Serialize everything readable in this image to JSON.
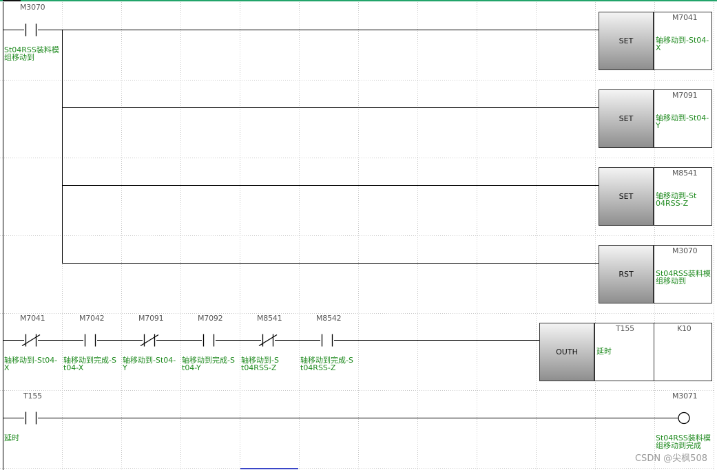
{
  "rungs": [
    {
      "contacts": [
        {
          "device": "M3070",
          "type": "no",
          "comment": "St04RSS装料模组移动到"
        }
      ],
      "outputs": [
        {
          "instruction": "SET",
          "device": "M7041",
          "comment": "轴移动到-St04-X"
        },
        {
          "instruction": "SET",
          "device": "M7091",
          "comment": "轴移动到-St04-Y"
        },
        {
          "instruction": "SET",
          "device": "M8541",
          "comment": "轴移动到-St04RSS-Z"
        },
        {
          "instruction": "RST",
          "device": "M3070",
          "comment": "St04RSS装料模组移动到"
        }
      ]
    },
    {
      "contacts": [
        {
          "device": "M7041",
          "type": "nc",
          "comment": "轴移动到-St04-X"
        },
        {
          "device": "M7042",
          "type": "no",
          "comment": "轴移动到完成-St04-X"
        },
        {
          "device": "M7091",
          "type": "nc",
          "comment": "轴移动到-St04-Y"
        },
        {
          "device": "M7092",
          "type": "no",
          "comment": "轴移动到完成-St04-Y"
        },
        {
          "device": "M8541",
          "type": "nc",
          "comment": "轴移动到-St04RSS-Z"
        },
        {
          "device": "M8542",
          "type": "no",
          "comment": "轴移动到完成-St04RSS-Z"
        }
      ],
      "outputs": [
        {
          "instruction": "OUTH",
          "device": "T155",
          "constant": "K10",
          "comment": "延时"
        }
      ]
    },
    {
      "contacts": [
        {
          "device": "T155",
          "type": "no",
          "comment": "延时"
        }
      ],
      "outputs": [
        {
          "instruction": "coil",
          "device": "M3071",
          "comment": "St04RSS装料模组移动到完成"
        }
      ]
    }
  ],
  "watermark": "CSDN @尖枫508",
  "colors": {
    "line": "#000000",
    "grid": "#c8c8c8",
    "comment": "#1f8a1f",
    "header": "#21a46a"
  }
}
